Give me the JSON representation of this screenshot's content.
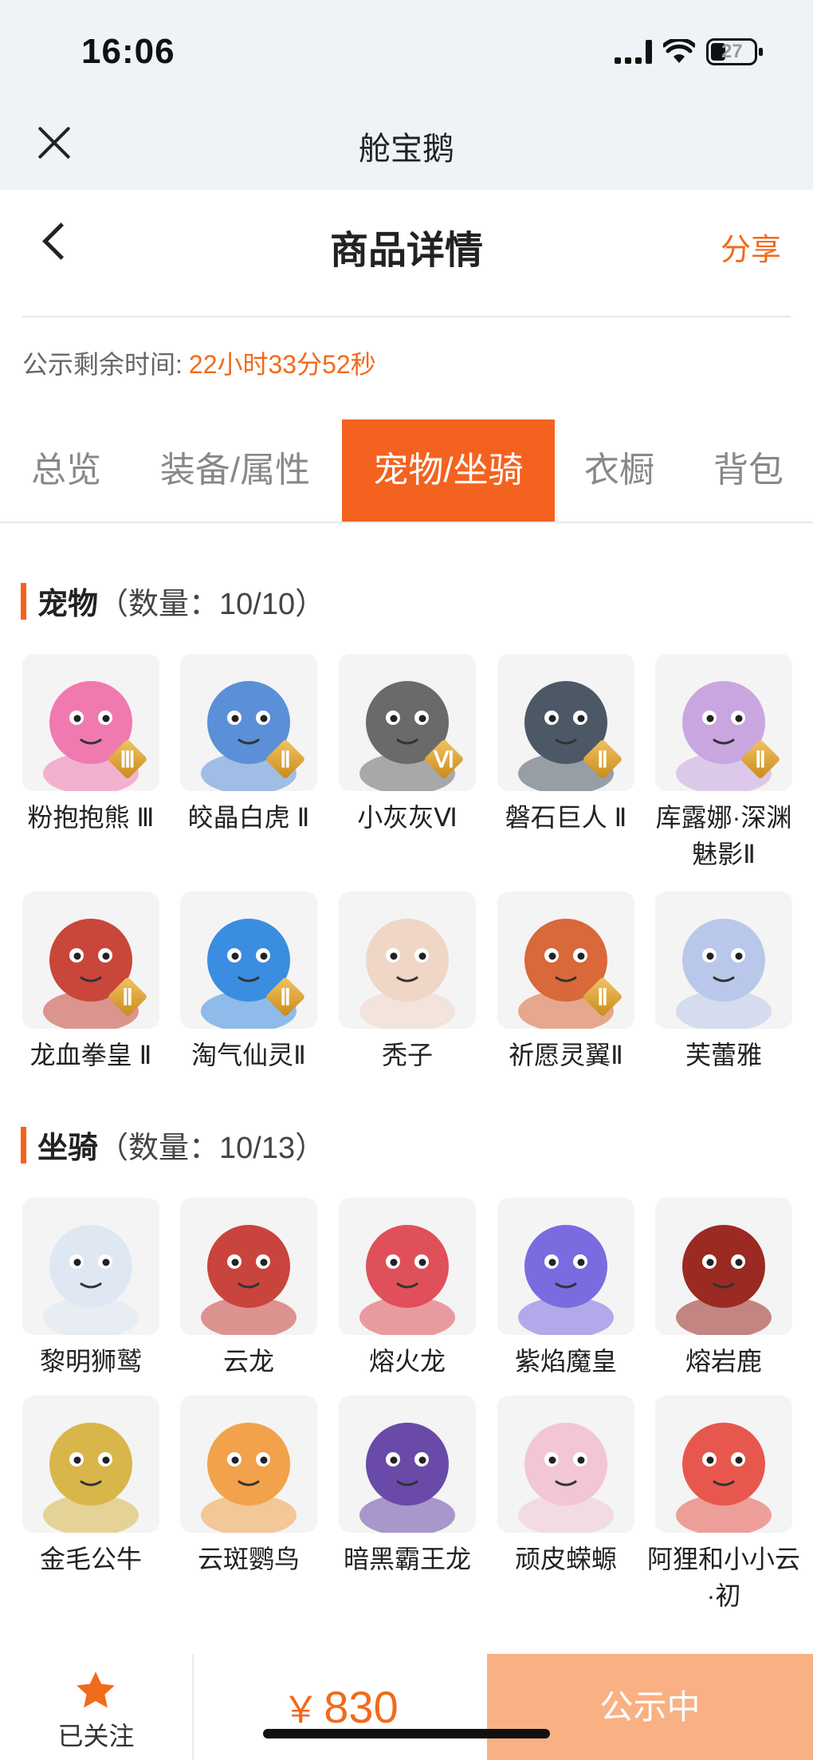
{
  "status_bar": {
    "time": "16:06",
    "battery": "27"
  },
  "mini_program": {
    "title": "舱宝鹅"
  },
  "header": {
    "title": "商品详情",
    "share": "分享"
  },
  "countdown": {
    "label": "公示剩余时间:",
    "value": "22小时33分52秒"
  },
  "tabs": [
    {
      "label": "总览",
      "active": false
    },
    {
      "label": "装备/属性",
      "active": false
    },
    {
      "label": "宠物/坐骑",
      "active": true
    },
    {
      "label": "衣橱",
      "active": false
    },
    {
      "label": "背包",
      "active": false
    }
  ],
  "pets": {
    "title": "宠物",
    "count": "（数量：10/10）",
    "items": [
      {
        "name": "粉抱抱熊 Ⅲ",
        "grade": "Ⅲ",
        "color": "#f07ab0"
      },
      {
        "name": "皎晶白虎 Ⅱ",
        "grade": "Ⅱ",
        "color": "#5b8fd8"
      },
      {
        "name": "小灰灰Ⅵ",
        "grade": "Ⅵ",
        "color": "#6a6a6a"
      },
      {
        "name": "磐石巨人 Ⅱ",
        "grade": "Ⅱ",
        "color": "#4d5866"
      },
      {
        "name": "库露娜·深渊魅影Ⅱ",
        "grade": "Ⅱ",
        "color": "#c9a6e0"
      },
      {
        "name": "龙血拳皇 Ⅱ",
        "grade": "Ⅱ",
        "color": "#c9463a"
      },
      {
        "name": "淘气仙灵Ⅱ",
        "grade": "Ⅱ",
        "color": "#3a8de0"
      },
      {
        "name": "秃子",
        "grade": "",
        "color": "#f0d6c6"
      },
      {
        "name": "祈愿灵翼Ⅱ",
        "grade": "Ⅱ",
        "color": "#d9683a"
      },
      {
        "name": "芙蕾雅",
        "grade": "",
        "color": "#b9c8ea"
      }
    ]
  },
  "mounts": {
    "title": "坐骑",
    "count": "（数量：10/13）",
    "items": [
      {
        "name": "黎明狮鹫",
        "color": "#dfe8f2"
      },
      {
        "name": "云龙",
        "color": "#c9443c"
      },
      {
        "name": "熔火龙",
        "color": "#e0505a"
      },
      {
        "name": "紫焰魔皇",
        "color": "#7a6be0"
      },
      {
        "name": "熔岩鹿",
        "color": "#9a2a22"
      },
      {
        "name": "金毛公牛",
        "color": "#d9b64a"
      },
      {
        "name": "云斑鹦鸟",
        "color": "#f2a24a"
      },
      {
        "name": "暗黑霸王龙",
        "color": "#6a4aa8"
      },
      {
        "name": "顽皮蝾螈",
        "color": "#f2c6d6"
      },
      {
        "name": "阿狸和小小云·初",
        "color": "#e8574e"
      }
    ]
  },
  "bottom": {
    "follow": "已关注",
    "currency": "￥",
    "price": "830",
    "action": "公示中"
  }
}
